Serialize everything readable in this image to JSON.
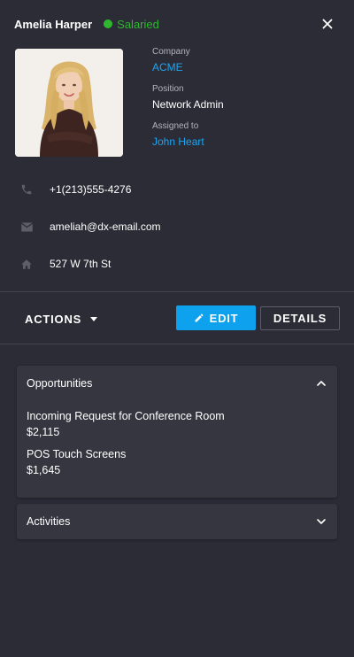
{
  "contact": {
    "name": "Amelia Harper",
    "status": "Salaried",
    "photo_alt": "Amelia Harper"
  },
  "details": {
    "company_label": "Company",
    "company_value": "ACME",
    "position_label": "Position",
    "position_value": "Network Admin",
    "assigned_label": "Assigned to",
    "assigned_value": "John Heart"
  },
  "contact_info": {
    "phone": "+1(213)555-4276",
    "email": "ameliah@dx-email.com",
    "address": "527 W 7th St"
  },
  "toolbar": {
    "actions_label": "ACTIONS",
    "edit_label": "EDIT",
    "details_label": "DETAILS"
  },
  "opportunities": {
    "title": "Opportunities",
    "items": [
      {
        "name": "Incoming Request for Conference Room",
        "amount": "$2,115"
      },
      {
        "name": "POS Touch Screens",
        "amount": "$1,645"
      }
    ]
  },
  "activities": {
    "title": "Activities"
  },
  "colors": {
    "background": "#2c2c37",
    "accent": "#0ea2ee",
    "link": "#1ea4ef",
    "status": "#2eb82e"
  },
  "icons": [
    "close-icon",
    "phone-icon",
    "email-icon",
    "home-icon",
    "caret-down-icon",
    "pencil-icon",
    "chevron-up-icon",
    "chevron-down-icon"
  ]
}
